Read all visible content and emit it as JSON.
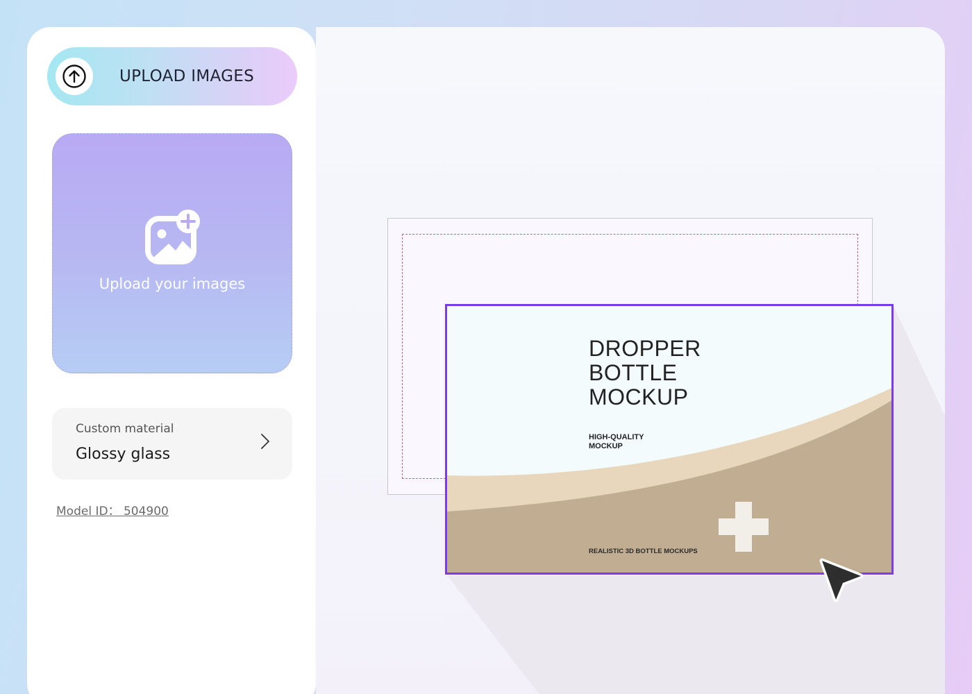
{
  "sidebar": {
    "upload_button_label": "UPLOAD IMAGES",
    "dropzone_label": "Upload your images",
    "material": {
      "caption": "Custom material",
      "value": "Glossy glass"
    },
    "model_id": "Model ID： 504900"
  },
  "canvas": {
    "label": {
      "title_lines": [
        "DROPPER",
        "BOTTLE",
        "MOCKUP"
      ],
      "subtitle_lines": [
        "HIGH-QUALITY",
        "MOCKUP"
      ],
      "footer": "REALISTIC 3D BOTTLE MOCKUPS"
    }
  },
  "icons": {
    "upload": "arrow-up-circle-icon",
    "add_image": "image-plus-icon",
    "chevron": "chevron-right-icon",
    "cursor": "pointer-cursor-icon",
    "plus": "plus-cross-icon"
  },
  "colors": {
    "selection": "#7c3aed",
    "label_background": "#f3fbfc",
    "wave_light": "#e8d7bc",
    "wave_dark": "#c1ad91",
    "plus": "#f2efe9"
  }
}
